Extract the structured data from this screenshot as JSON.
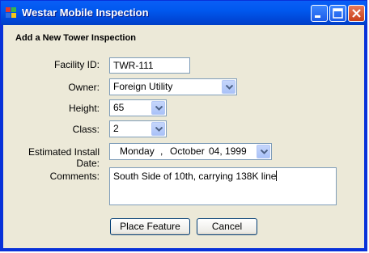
{
  "window": {
    "title": "Westar Mobile Inspection"
  },
  "form": {
    "heading": "Add a New Tower Inspection",
    "facility_id": {
      "label": "Facility ID:",
      "value": "TWR-111"
    },
    "owner": {
      "label": "Owner:",
      "value": "Foreign Utility"
    },
    "height": {
      "label": "Height:",
      "value": "65"
    },
    "class": {
      "label": "Class:",
      "value": "2"
    },
    "install_date": {
      "label": "Estimated Install Date:",
      "weekday": "Monday",
      "sep": ",",
      "month": "October",
      "day": "04, 1999"
    },
    "comments": {
      "label": "Comments:",
      "value": "South Side of 10th, carrying 138K line"
    }
  },
  "buttons": {
    "place_feature": "Place Feature",
    "cancel": "Cancel"
  },
  "icons": {
    "app": "app-icon",
    "minimize": "minimize-icon",
    "maximize": "maximize-icon",
    "close": "close-icon",
    "dropdown": "chevron-down-icon"
  }
}
